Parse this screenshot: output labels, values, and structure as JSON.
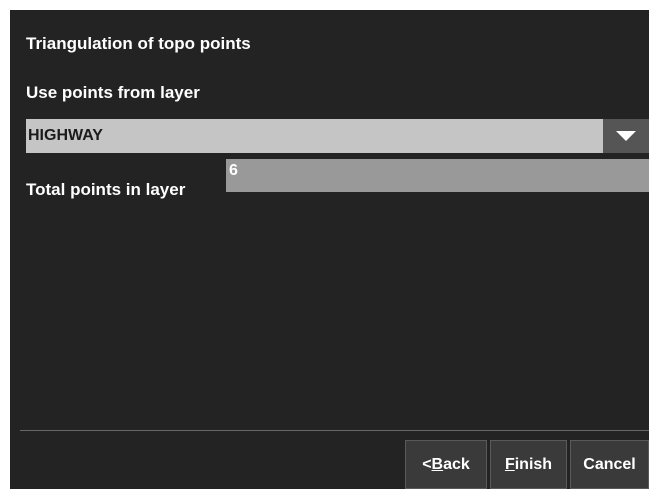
{
  "dialog": {
    "title": "Triangulation of topo points",
    "layer_label": "Use points from layer",
    "layer_value": "HIGHWAY",
    "total_label": "Total points in layer",
    "total_value": "6"
  },
  "icons": {
    "dropdown": "chevron-down-icon"
  },
  "buttons": {
    "back": {
      "prefix": "< ",
      "accel": "B",
      "rest": "ack"
    },
    "finish": {
      "accel": "F",
      "rest": "inish"
    },
    "cancel": "Cancel"
  },
  "colors": {
    "background": "#232323",
    "dropdown_bg": "#c5c5c5",
    "field_bg": "#999999",
    "text": "#ffffff"
  }
}
